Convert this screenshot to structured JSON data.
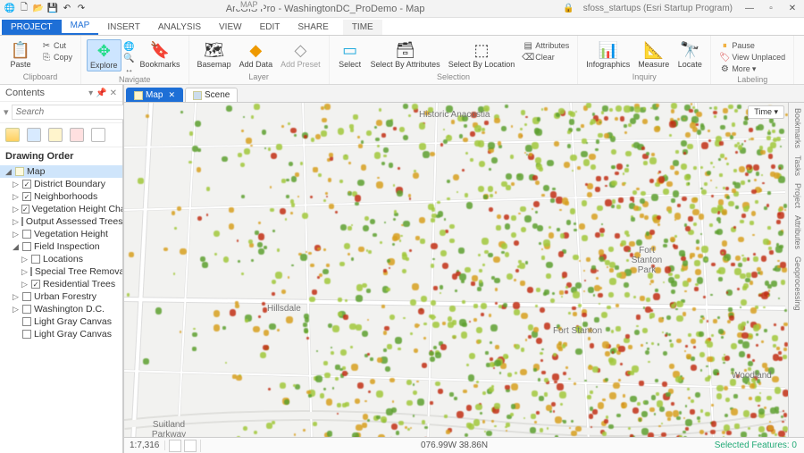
{
  "app": {
    "title": "ArcGIS Pro - WashingtonDC_ProDemo - Map",
    "signin": "sfoss_startups (Esri Startup Program)"
  },
  "context_tab": {
    "group": "MAP",
    "tab": "TIME"
  },
  "tabs": {
    "project": "PROJECT",
    "map": "MAP",
    "insert": "INSERT",
    "analysis": "ANALYSIS",
    "view": "VIEW",
    "edit": "EDIT",
    "share": "SHARE"
  },
  "ribbon": {
    "clipboard": {
      "paste": "Paste",
      "cut": "Cut",
      "copy": "Copy",
      "label": "Clipboard"
    },
    "navigate": {
      "explore": "Explore",
      "bookmarks": "Bookmarks",
      "label": "Navigate"
    },
    "layer": {
      "basemap": "Basemap",
      "adddata": "Add Data",
      "addpreset": "Add Preset",
      "label": "Layer"
    },
    "selection": {
      "select": "Select",
      "byattr": "Select By Attributes",
      "byloc": "Select By Location",
      "attrs": "Attributes",
      "clear": "Clear",
      "label": "Selection"
    },
    "inquiry": {
      "info": "Infographics",
      "measure": "Measure",
      "locate": "Locate",
      "label": "Inquiry"
    },
    "labeling": {
      "pause": "Pause",
      "unplaced": "View Unplaced",
      "more": "More",
      "label": "Labeling"
    }
  },
  "contents": {
    "title": "Contents",
    "search_placeholder": "Search",
    "section": "Drawing Order",
    "root": "Map",
    "layers": {
      "district": "District Boundary",
      "neighborhoods": "Neighborhoods",
      "vhc": "Vegetation Height Change",
      "oat": "Output Assessed Trees",
      "vh": "Vegetation Height",
      "fi": "Field Inspection",
      "loc": "Locations",
      "str": "Special Tree Removals",
      "rt": "Residential Trees",
      "uf": "Urban Forestry",
      "wdc": "Washington D.C.",
      "lgc1": "Light Gray Canvas",
      "lgc2": "Light Gray Canvas"
    }
  },
  "viewtabs": {
    "map": "Map",
    "scene": "Scene"
  },
  "map_labels": {
    "anacostia": "Historic Anacostia",
    "hillsdale": "Hillsdale",
    "fortstanton": "Fort Stanton",
    "woodland": "Woodland",
    "suitland": "Suitland Parkway",
    "fsp": "Fort Stanton Park"
  },
  "time_btn": "Time",
  "status": {
    "scale": "1:7,316",
    "coords": "076.99W 38.86N",
    "selected": "Selected Features: 0"
  },
  "right_tabs": {
    "bookmarks": "Bookmarks",
    "tasks": "Tasks",
    "project": "Project",
    "attributes": "Attributes",
    "geoprocessing": "Geoprocessing"
  }
}
